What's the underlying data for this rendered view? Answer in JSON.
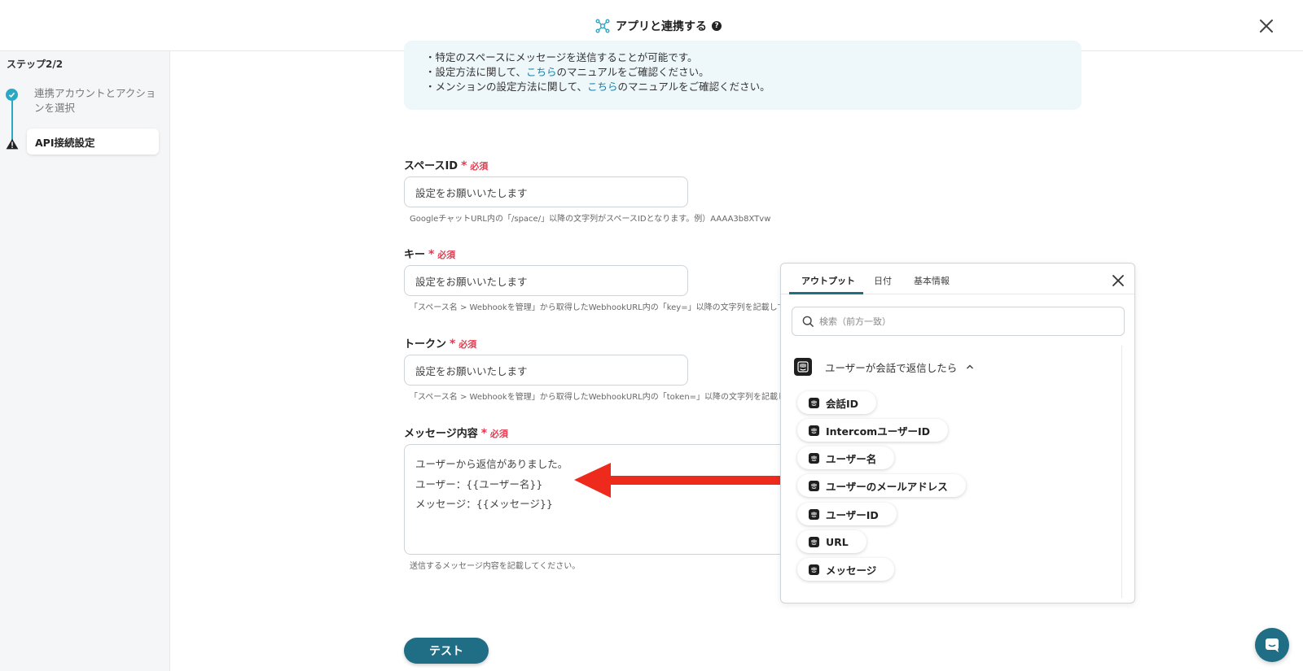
{
  "header": {
    "title": "アプリと連携する",
    "help_icon": "?",
    "close_icon": "close-icon"
  },
  "sidebar": {
    "step_count": "ステップ2/2",
    "steps": [
      {
        "label": "連携アカウントとアクションを選択",
        "status": "done"
      },
      {
        "label": "API接続設定",
        "status": "warning",
        "active": true
      }
    ]
  },
  "info": {
    "lines": [
      {
        "prefix": "・特定のスペースにメッセージを送信することが可能です。"
      },
      {
        "prefix": "・設定方法に関して、",
        "link": "こちら",
        "suffix": "のマニュアルをご確認ください。"
      },
      {
        "prefix": "・メンションの設定方法に関して、",
        "link": "こちら",
        "suffix": "のマニュアルをご確認ください。"
      }
    ]
  },
  "required_label": "必須",
  "fields": {
    "space_id": {
      "label": "スペースID",
      "placeholder": "設定をお願いいたします",
      "hint": "GoogleチャットURL内の「/space/」以降の文字列がスペースIDとなります。例）AAAA3b8XTvw"
    },
    "key": {
      "label": "キー",
      "placeholder": "設定をお願いいたします",
      "hint": "「スペース名 > Webhookを管理」から取得したWebhookURL内の「key=」以降の文字列を記載してく"
    },
    "token": {
      "label": "トークン",
      "placeholder": "設定をお願いいたします",
      "hint": "「スペース名 > Webhookを管理」から取得したWebhookURL内の「token=」以降の文字列を記載して"
    },
    "message": {
      "label": "メッセージ内容",
      "lines": [
        "ユーザーから返信がありました。",
        "ユーザー：{{ユーザー名}}",
        "メッセージ：{{メッセージ}}"
      ],
      "hint": "送信するメッセージ内容を記載してください。"
    }
  },
  "test_button": "テスト",
  "panel": {
    "tabs": [
      "アウトプット",
      "日付",
      "基本情報"
    ],
    "active_tab": "アウトプット",
    "search_placeholder": "検索（前方一致）",
    "section_title": "ユーザーが会話で返信したら",
    "chips": [
      "会話ID",
      "IntercomユーザーID",
      "ユーザー名",
      "ユーザーのメールアドレス",
      "ユーザーID",
      "URL",
      "メッセージ"
    ]
  },
  "colors": {
    "accent": "#1f6e86",
    "step_done": "#2aa8c4",
    "required": "#e8384f",
    "arrow": "#ee2a1c",
    "info_bg": "#eef7fa"
  }
}
